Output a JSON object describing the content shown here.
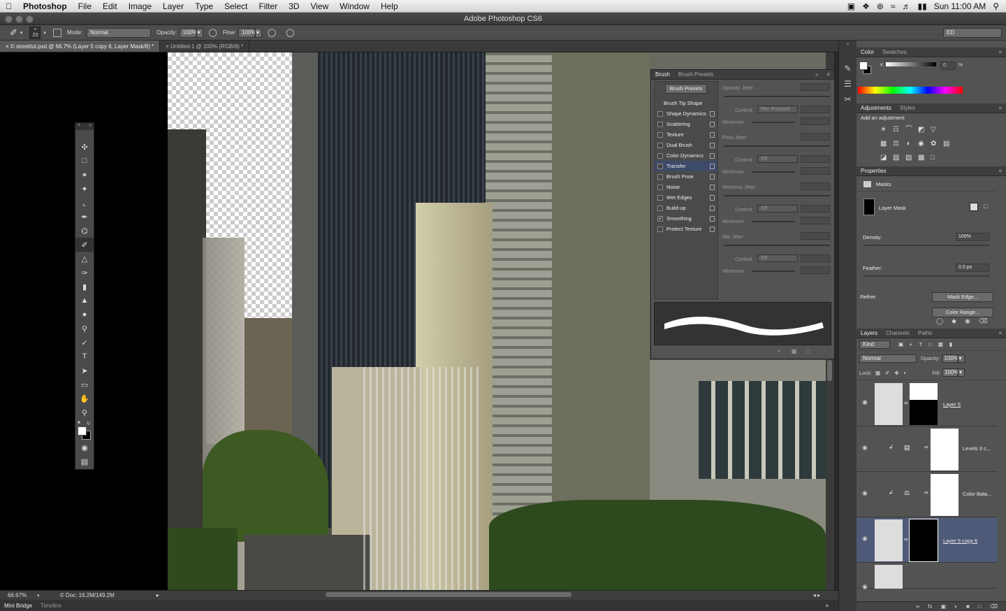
{
  "menubar": {
    "items": [
      "Photoshop",
      "File",
      "Edit",
      "Image",
      "Layer",
      "Type",
      "Select",
      "Filter",
      "3D",
      "View",
      "Window",
      "Help"
    ],
    "clock": "Sun 11:00 AM"
  },
  "window": {
    "title": "Adobe Photoshop CS6"
  },
  "options": {
    "brush_size": "23",
    "mode_label": "Mode:",
    "mode_value": "Normal",
    "opacity_label": "Opacity:",
    "opacity_value": "100%",
    "flow_label": "Flow:",
    "flow_value": "100%",
    "workspace": "ED"
  },
  "tabs": [
    "© streettut.psd @ 66.7% (Layer 5 copy 6, Layer Mask/8) *",
    "Untitled-1 @ 100% (RGB/8) *"
  ],
  "status": {
    "zoom": "66.67%",
    "doc": "© Doc: 16.2M/149.2M"
  },
  "bottom_tabs": [
    "Mini Bridge",
    "Timeline"
  ],
  "brush_panel": {
    "tabs": [
      "Brush",
      "Brush Presets"
    ],
    "presets_button": "Brush Presets",
    "tip_shape": "Brush Tip Shape",
    "options": [
      {
        "label": "Shape Dynamics",
        "checked": false
      },
      {
        "label": "Scattering",
        "checked": false
      },
      {
        "label": "Texture",
        "checked": false
      },
      {
        "label": "Dual Brush",
        "checked": false
      },
      {
        "label": "Color Dynamics",
        "checked": false
      },
      {
        "label": "Transfer",
        "checked": false,
        "selected": true
      },
      {
        "label": "Brush Pose",
        "checked": false
      },
      {
        "label": "Noise",
        "checked": false
      },
      {
        "label": "Wet Edges",
        "checked": false
      },
      {
        "label": "Build-up",
        "checked": false
      },
      {
        "label": "Smoothing",
        "checked": true
      },
      {
        "label": "Protect Texture",
        "checked": false
      }
    ],
    "right": {
      "opacity_jitter": "Opacity Jitter",
      "control": "Control:",
      "pen_pressure": "Pen Pressure",
      "minimum": "Minimum",
      "flow_jitter": "Flow Jitter",
      "off": "Off",
      "wetness_jitter": "Wetness Jitter",
      "mix_jitter": "Mix Jitter"
    }
  },
  "color_panel": {
    "tabs": [
      "Color",
      "Swatches"
    ],
    "channel": "K",
    "value": "0",
    "unit": "%"
  },
  "adjustments": {
    "tabs": [
      "Adjustments",
      "Styles"
    ],
    "heading": "Add an adjustment"
  },
  "properties": {
    "title": "Properties",
    "section": "Masks",
    "mask_label": "Layer Mask",
    "density_label": "Density:",
    "density_value": "100%",
    "feather_label": "Feather:",
    "feather_value": "0.0 px",
    "refine_label": "Refine:",
    "mask_edge": "Mask Edge...",
    "color_range": "Color Range..."
  },
  "layers": {
    "tabs": [
      "Layers",
      "Channels",
      "Paths"
    ],
    "kind": "Kind",
    "blend": "Normal",
    "opacity_label": "Opacity:",
    "opacity_value": "100%",
    "lock_label": "Lock:",
    "fill_label": "Fill:",
    "fill_value": "100%",
    "items": [
      {
        "name": "Layer 5",
        "selected": false
      },
      {
        "name": "Levels 3 c...",
        "selected": false
      },
      {
        "name": "Color Bala...",
        "selected": false
      },
      {
        "name": "Layer 5 copy 6",
        "selected": true
      }
    ]
  }
}
